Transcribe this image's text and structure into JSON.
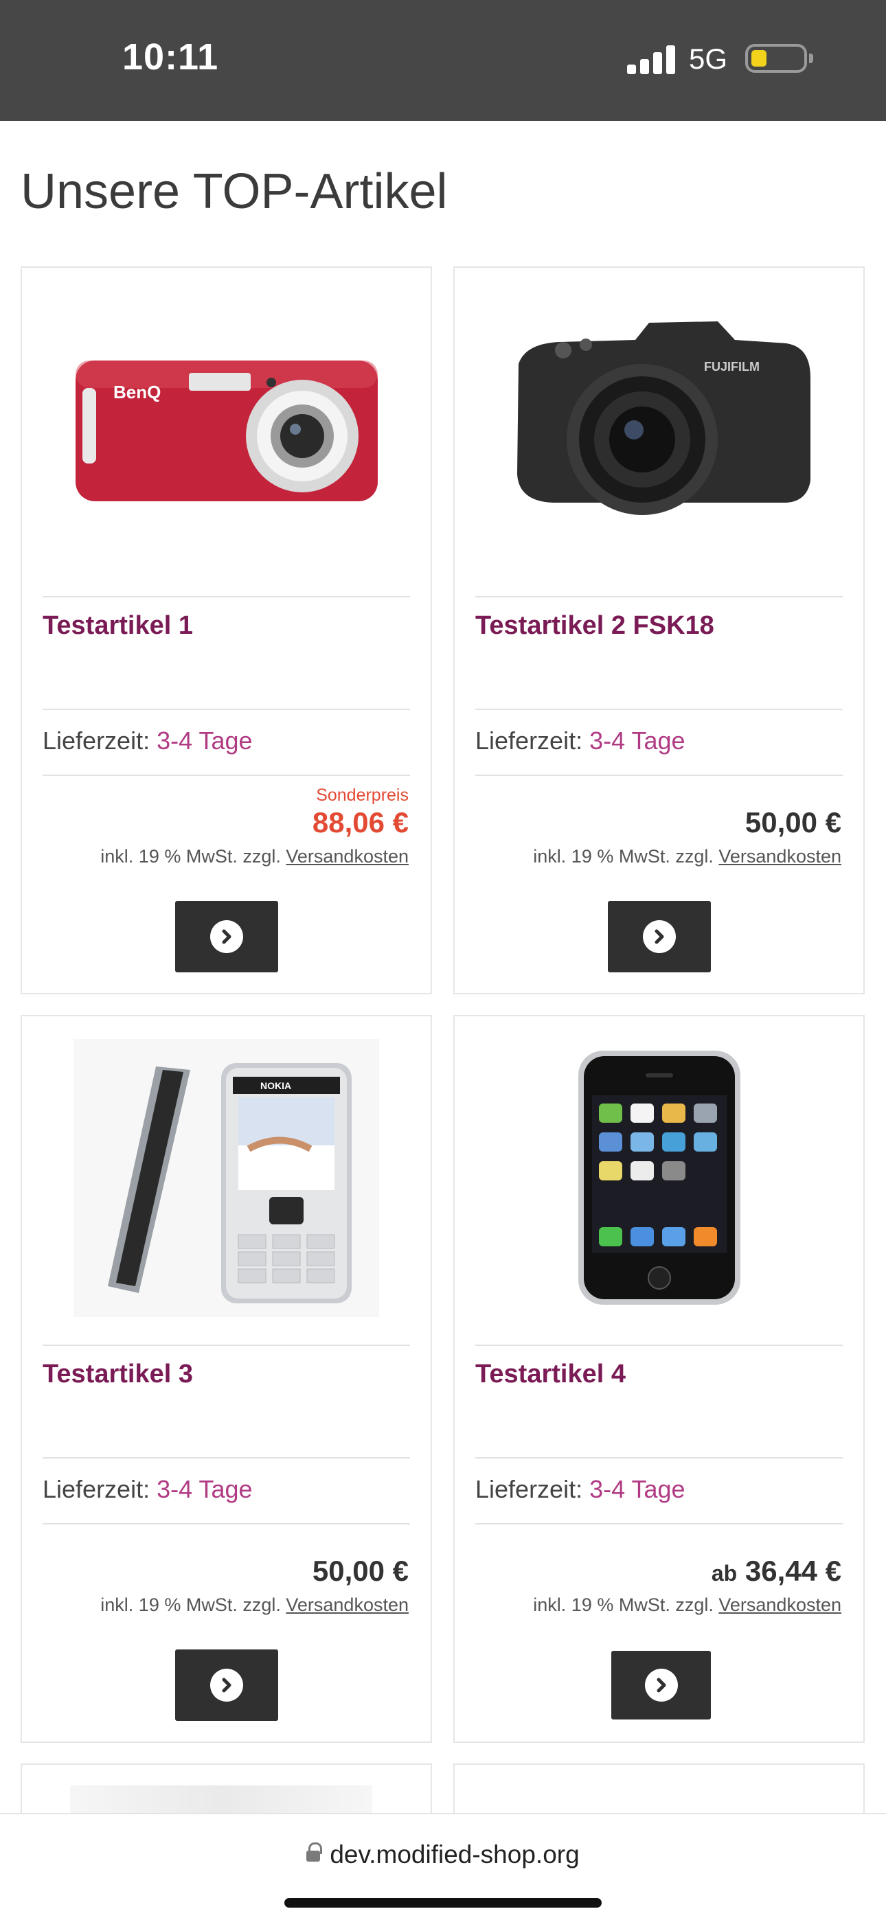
{
  "status_bar": {
    "time": "10:11",
    "network": "5G"
  },
  "page": {
    "title": "Unsere TOP-Artikel"
  },
  "labels": {
    "delivery_label": "Lieferzeit:",
    "tax_text": "inkl. 19 % MwSt. zzgl.",
    "shipping_link": "Versandkosten",
    "special_label": "Sonderpreis",
    "from_prefix": "ab"
  },
  "products": [
    {
      "name": "Testartikel 1",
      "delivery": "3-4 Tage",
      "price": "88,06 €",
      "special": true,
      "image": "red-compact-camera"
    },
    {
      "name": "Testartikel 2 FSK18",
      "delivery": "3-4 Tage",
      "price": "50,00 €",
      "special": false,
      "image": "black-bridge-camera"
    },
    {
      "name": "Testartikel 3",
      "delivery": "3-4 Tage",
      "price": "50,00 €",
      "special": false,
      "image": "nokia-phone"
    },
    {
      "name": "Testartikel 4",
      "delivery": "3-4 Tage",
      "price": "36,44 €",
      "special": false,
      "from": true,
      "image": "iphone"
    }
  ],
  "product_images": {
    "camera1_brand": "BenQ",
    "camera2_brand": "FUJIFILM",
    "phone_brand": "NOKIA"
  },
  "browser": {
    "url": "dev.modified-shop.org"
  },
  "colors": {
    "accent": "#7a1b55",
    "delivery": "#b03a83",
    "special_price": "#e34a33",
    "status_bar": "#474747"
  }
}
